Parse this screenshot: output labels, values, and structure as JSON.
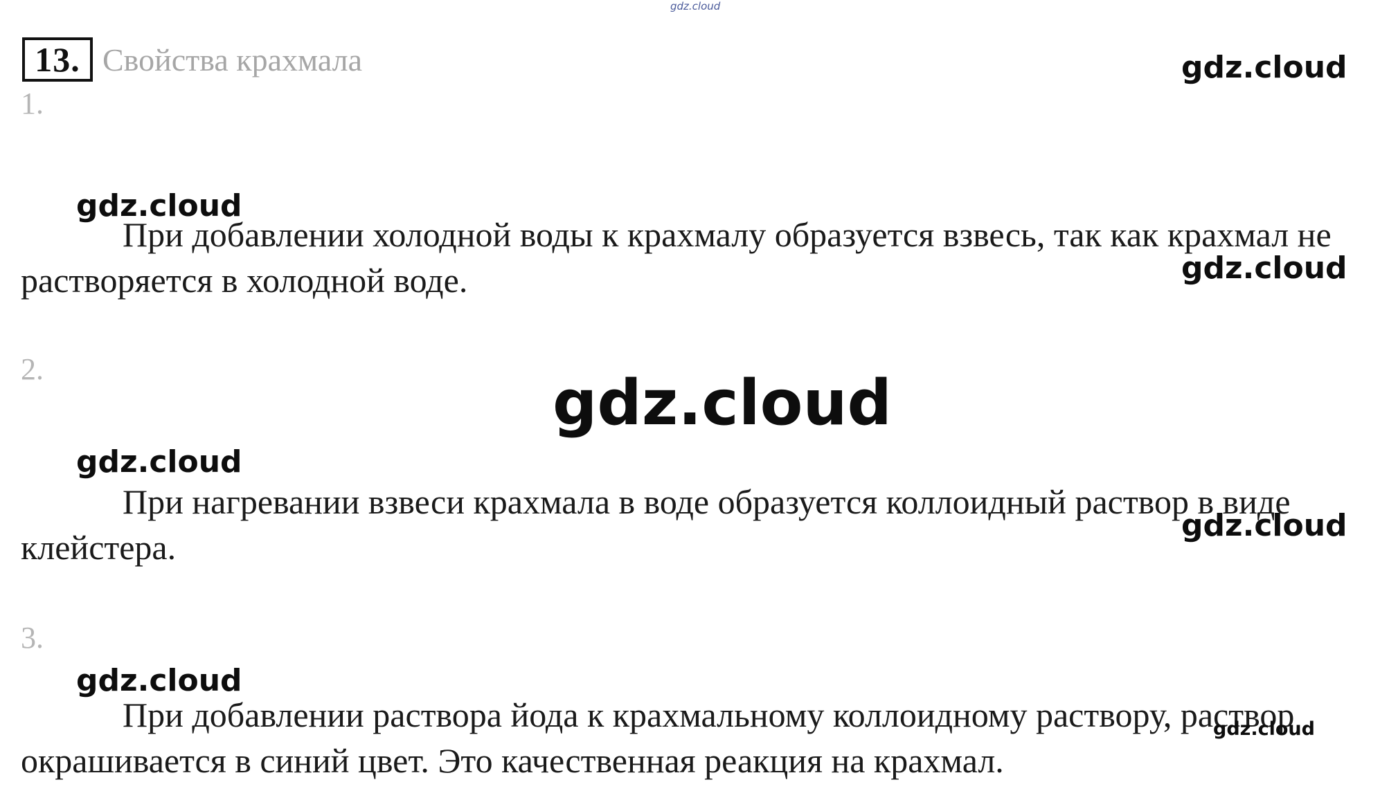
{
  "watermark": "gdz.cloud",
  "task": {
    "number": "13.",
    "title": "Свойства крахмала"
  },
  "items": [
    {
      "number": "1.",
      "text": "При добавлении холодной воды к крахмалу образуется взвесь, так как крахмал не растворяется в холодной воде."
    },
    {
      "number": "2.",
      "text": "При нагревании взвеси крахмала в воде образуется коллоидный раствор в виде клейстера."
    },
    {
      "number": "3.",
      "text": "При добавлении раствора йода к крахмальному коллоидному раствору, раствор окрашивается в синий цвет. Это качественная реакция на крахмал."
    }
  ]
}
